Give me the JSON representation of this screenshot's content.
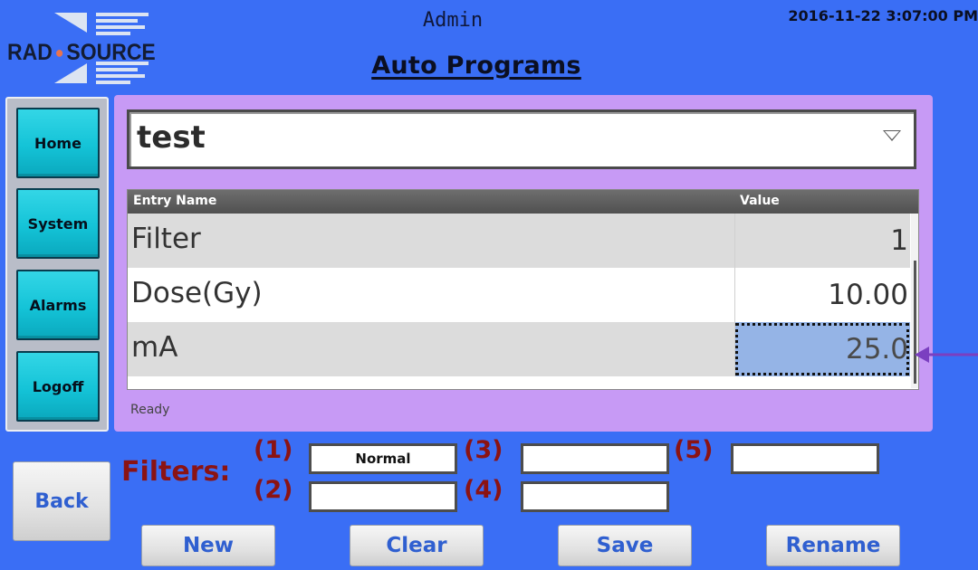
{
  "header": {
    "brand_left": "RAD",
    "brand_right": "SOURCE",
    "user_role": "Admin",
    "datetime": "2016-11-22 3:07:00 PM",
    "page_title": "Auto Programs"
  },
  "nav": {
    "items": [
      {
        "label": "Home"
      },
      {
        "label": "System"
      },
      {
        "label": "Alarms"
      },
      {
        "label": "Logoff"
      }
    ]
  },
  "program": {
    "selected": "test",
    "dropdown_icon": "triangle-down-icon"
  },
  "grid": {
    "columns": [
      "Entry Name",
      "Value"
    ],
    "rows": [
      {
        "name": "Filter",
        "value": "1"
      },
      {
        "name": "Dose(Gy)",
        "value": "10.00"
      },
      {
        "name": "mA",
        "value": "25.0"
      }
    ],
    "selected_row_index": 2
  },
  "status": {
    "text": "Ready"
  },
  "filters": {
    "label": "Filters:",
    "slots": [
      {
        "number": "(1)",
        "value": "Normal"
      },
      {
        "number": "(2)",
        "value": ""
      },
      {
        "number": "(3)",
        "value": ""
      },
      {
        "number": "(4)",
        "value": ""
      },
      {
        "number": "(5)",
        "value": ""
      }
    ]
  },
  "buttons": {
    "back": "Back",
    "new": "New",
    "clear": "Clear",
    "save": "Save",
    "rename": "Rename"
  },
  "colors": {
    "background": "#3a6ef5",
    "panel": "#c79af5",
    "nav_button": "#14c3d7",
    "filter_label": "#8b1313",
    "action_text": "#2f5fd0",
    "arrow": "#7b3fc0"
  }
}
